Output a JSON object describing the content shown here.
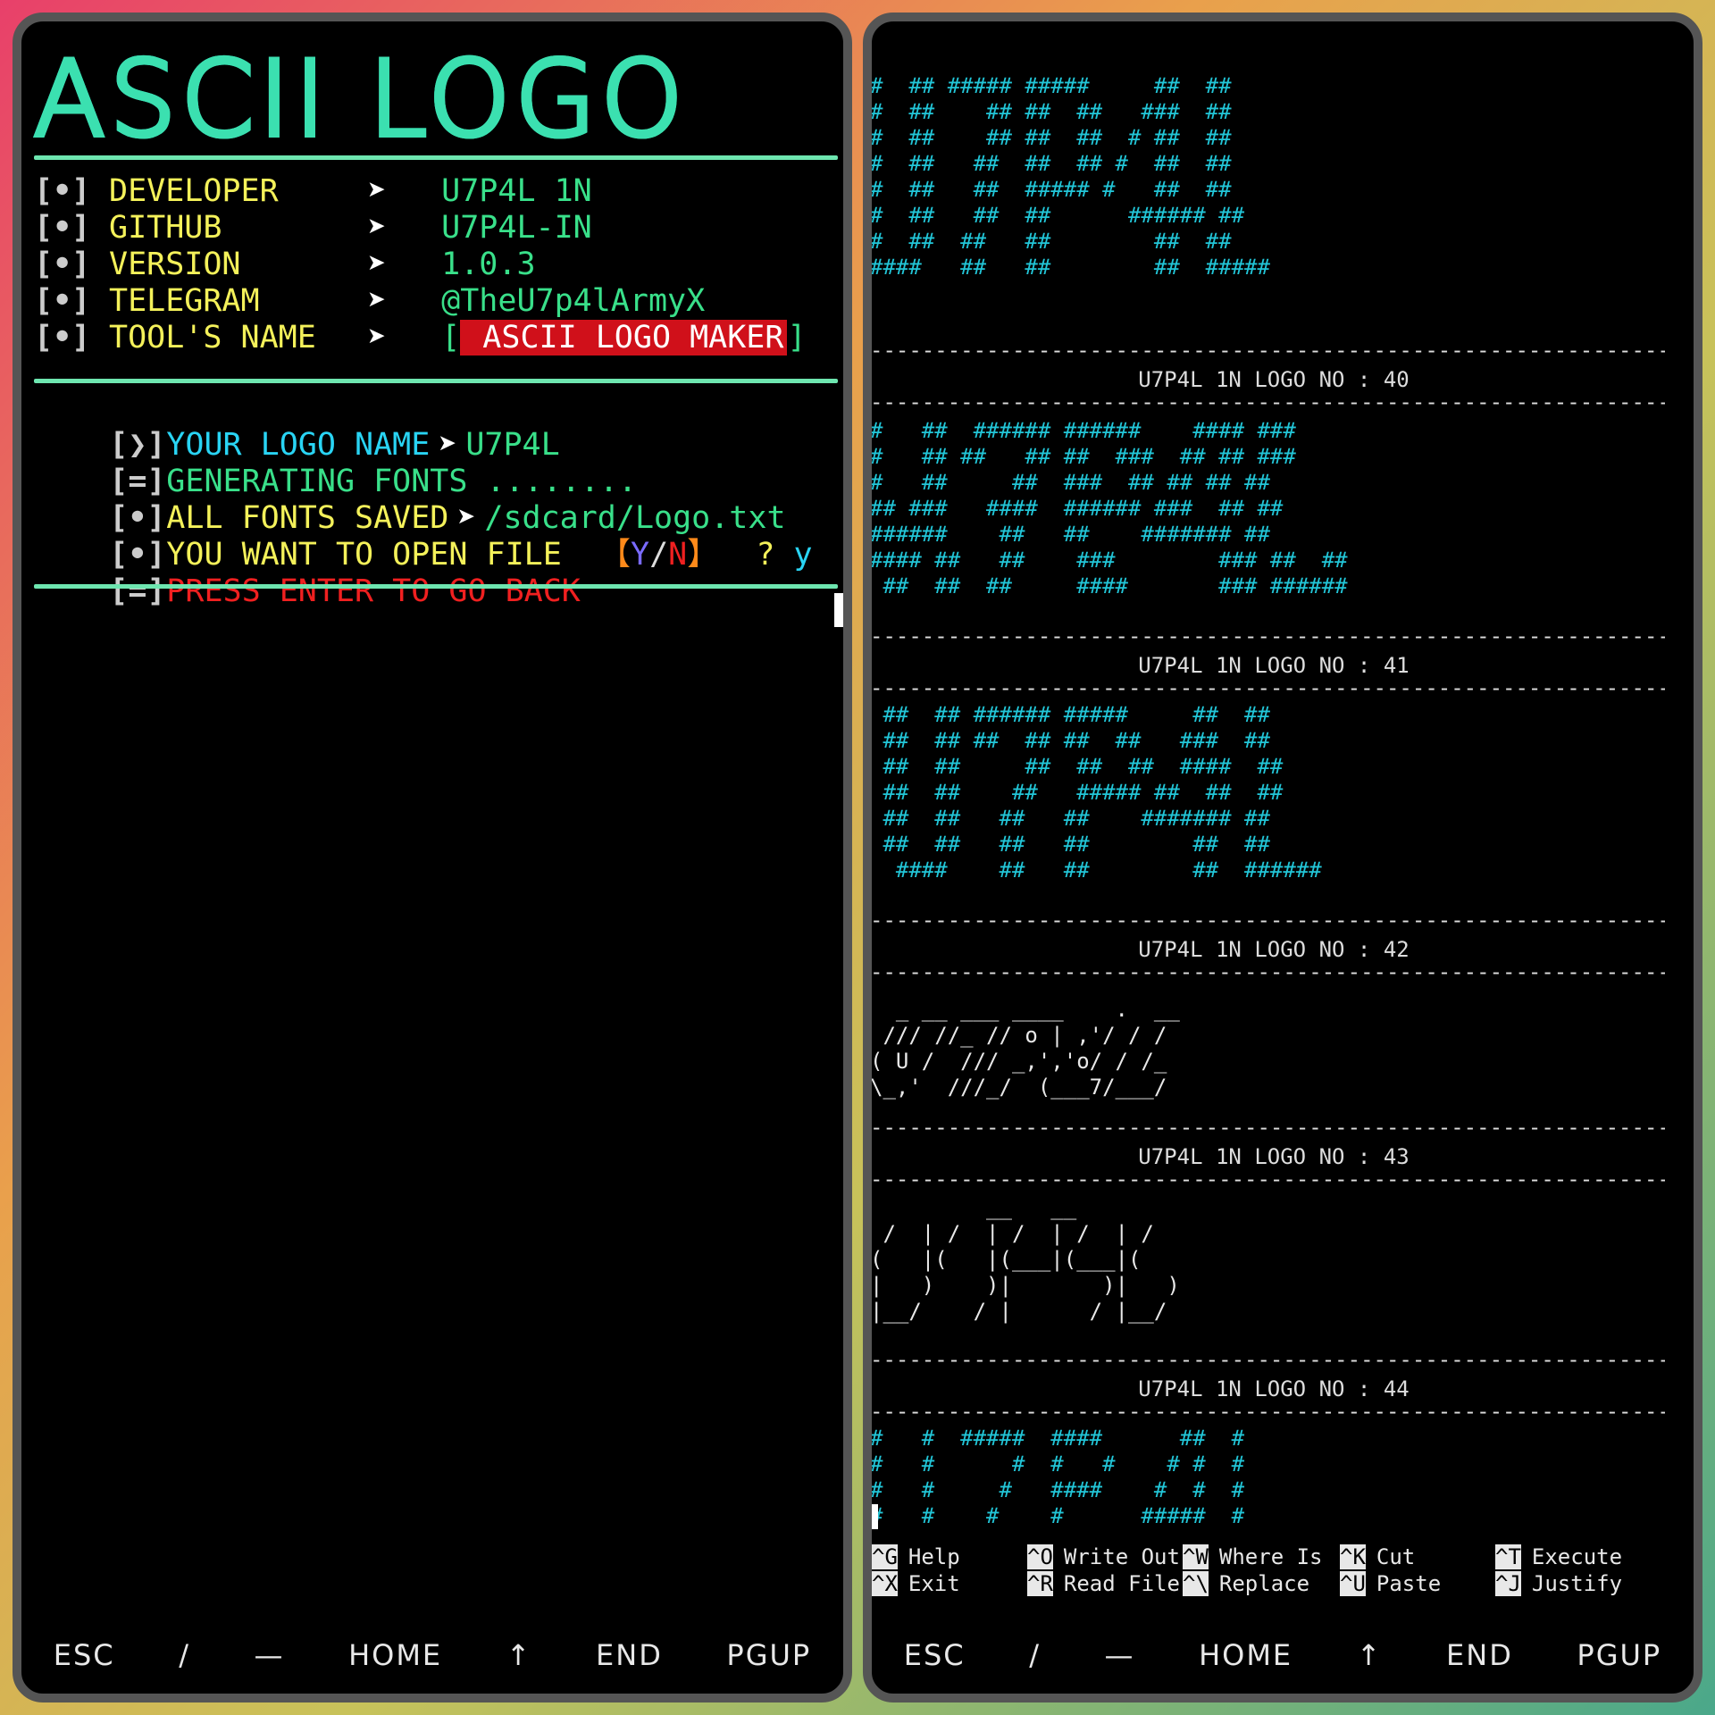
{
  "left_terminal": {
    "title": "ASCII LOGO",
    "info": [
      {
        "bracket": "[•]",
        "label": "DEVELOPER",
        "arrow": "➤",
        "value": "U7P4L 1N"
      },
      {
        "bracket": "[•]",
        "label": "GITHUB",
        "arrow": "➤",
        "value": "U7P4L-IN"
      },
      {
        "bracket": "[•]",
        "label": "VERSION",
        "arrow": "➤",
        "value": "1.0.3"
      },
      {
        "bracket": "[•]",
        "label": "TELEGRAM",
        "arrow": "➤",
        "value": "@TheU7p4lArmyX"
      },
      {
        "bracket": "[•]",
        "label": "TOOL'S NAME",
        "arrow": "➤",
        "value_open": "[",
        "value": " ASCII LOGO MAKER",
        "value_close": "]"
      }
    ],
    "session": {
      "logo_name": {
        "bracket": "[❯]",
        "label": "YOUR LOGO NAME",
        "arrow": "➤",
        "value": "U7P4L"
      },
      "generating": {
        "bracket": "[=]",
        "text": "GENERATING FONTS ........"
      },
      "saved": {
        "bracket": "[•]",
        "label": "ALL FONTS SAVED",
        "arrow": "➤",
        "value": "/sdcard/Logo.txt"
      },
      "open_prompt": {
        "bracket": "[•]",
        "label": "YOU WANT TO OPEN FILE",
        "open": "【",
        "y": "Y",
        "slash": "/",
        "n": "N",
        "close": "】",
        "q": "?",
        "answer": "y"
      },
      "back": {
        "bracket": "[=]",
        "text": "PRESS ENTER TO GO BACK"
      }
    },
    "extra_keys": [
      "ESC",
      "/",
      "—",
      "HOME",
      "↑",
      "END",
      "PGUP"
    ]
  },
  "right_terminal": {
    "blocks": [
      {
        "caption": "",
        "style": "cyan",
        "art": "#  ## ##### #####     ##  ##\n#  ##    ## ##  ##   ###  ##\n#  ##    ## ##  ##  # ##  ##\n#  ##   ##  ##  ## #  ##  ##\n#  ##   ##  ##### #   ##  ##\n#  ##   ##  ##      ###### ##\n#  ##  ##   ##        ##  ##\n####   ##   ##        ##  #####"
      },
      {
        "caption": "U7P4L 1N LOGO NO : 40",
        "style": "cyan",
        "art": "#   ##  ###### ######    #### ###\n#   ## ##   ## ##  ###  ## ## ###\n#   ##     ##  ###  ## ## ## ##\n## ###   ####  ###### ###  ## ##\n######    ##   ##    ####### ##\n#### ##   ##    ###        ### ##  ##\n ##  ##  ##     ####       ### ######"
      },
      {
        "caption": "U7P4L 1N LOGO NO : 41",
        "style": "cyan",
        "art": " ##  ## ###### #####     ##  ##\n ##  ## ##  ## ##  ##   ###  ##\n ##  ##     ##  ##  ##  ####  ##\n ##  ##    ##   ##### ##  ##  ##\n ##  ##   ##   ##    ####### ##\n ##  ##   ##   ##        ##  ##\n  ####    ##   ##        ##  ######"
      },
      {
        "caption": "U7P4L 1N LOGO NO : 42",
        "style": "white",
        "art": "  _ __ ___ ____    .  __\n /// //_ // o | ,'/ / /\n( U /  /// _,','o/ / /_\n\\_,'  ///_/  (___7/___/"
      },
      {
        "caption": "U7P4L 1N LOGO NO : 43",
        "style": "white",
        "art": "         __   __\n /  | /  | /  | /  | /\n(   |(   |(___|(___|(\n|   )    )|       )|   )\n|__/    / |      / |__/"
      },
      {
        "caption": "U7P4L 1N LOGO NO : 44",
        "style": "cyan",
        "art": "#   #  #####  ####      ##  #\n#   #      #  #   #    # #  #\n#   #     #   ####    #  #  #\n#   #    #    #      #####  #"
      }
    ],
    "nano_help": [
      [
        {
          "key": "^G",
          "label": "Help"
        },
        {
          "key": "^O",
          "label": "Write Out"
        },
        {
          "key": "^W",
          "label": "Where Is"
        },
        {
          "key": "^K",
          "label": "Cut"
        },
        {
          "key": "^T",
          "label": "Execute"
        }
      ],
      [
        {
          "key": "^X",
          "label": "Exit"
        },
        {
          "key": "^R",
          "label": "Read File"
        },
        {
          "key": "^\\",
          "label": "Replace"
        },
        {
          "key": "^U",
          "label": "Paste"
        },
        {
          "key": "^J",
          "label": "Justify"
        }
      ]
    ],
    "extra_keys": [
      "ESC",
      "/",
      "—",
      "HOME",
      "↑",
      "END",
      "PGUP"
    ]
  },
  "colors": {
    "cyan_text": "#22c6d8",
    "green_text": "#39e08a",
    "yellow_text": "#f4f15a",
    "red_text": "#f02020",
    "rule": "#6ee6b0"
  }
}
